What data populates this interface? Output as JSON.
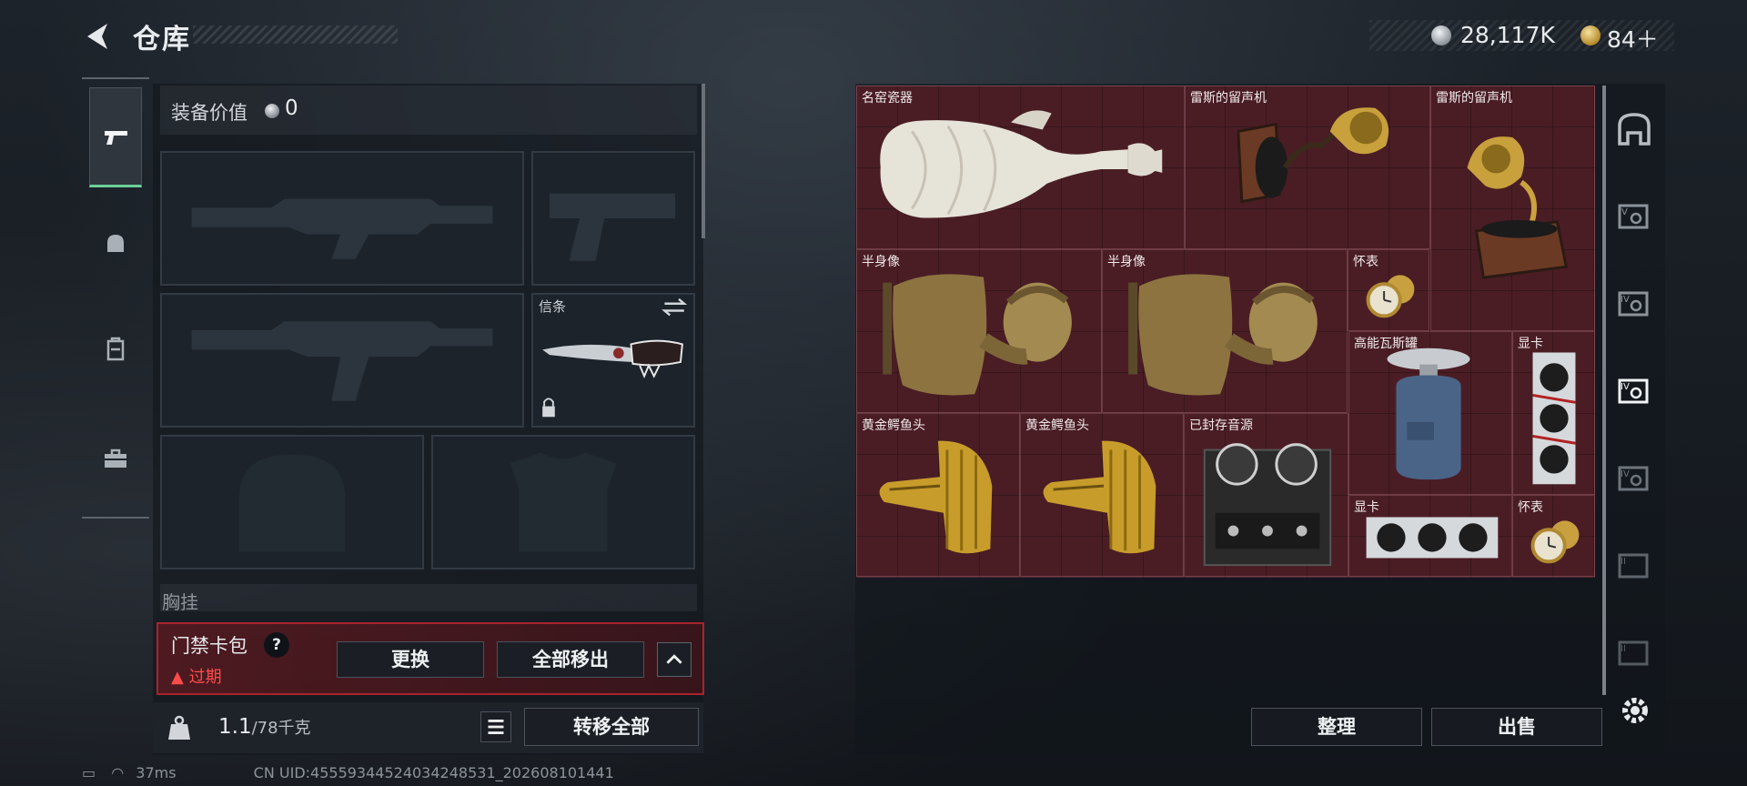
{
  "header": {
    "title": "仓库",
    "currency_silver": "28,117K",
    "currency_gold": "84＋"
  },
  "equipment": {
    "value_label": "装备价值",
    "value": "0",
    "melee_label": "信条",
    "chest_label": "胸挂"
  },
  "keycard": {
    "label": "门禁卡包",
    "help": "?",
    "status": "过期",
    "replace_button": "更换",
    "remove_all_button": "全部移出"
  },
  "weight": {
    "current": "1.1",
    "max": "/78千克",
    "transfer_all_button": "转移全部"
  },
  "stash": {
    "items": [
      {
        "name": "名窑瓷器",
        "kind": "vase"
      },
      {
        "name": "雷斯的留声机",
        "kind": "phonograph-1"
      },
      {
        "name": "雷斯的留声机",
        "kind": "phonograph-2"
      },
      {
        "name": "半身像",
        "kind": "bust"
      },
      {
        "name": "半身像",
        "kind": "bust"
      },
      {
        "name": "怀表",
        "kind": "pocket-watch"
      },
      {
        "name": "高能瓦斯罐",
        "kind": "gas-tank"
      },
      {
        "name": "显卡",
        "kind": "gpu-vertical"
      },
      {
        "name": "黄金鳄鱼头",
        "kind": "gold-croc"
      },
      {
        "name": "黄金鳄鱼头",
        "kind": "gold-croc"
      },
      {
        "name": "已封存音源",
        "kind": "reel-recorder"
      },
      {
        "name": "显卡",
        "kind": "gpu-horizontal"
      },
      {
        "name": "怀表",
        "kind": "pocket-watch"
      }
    ],
    "sort_button": "整理",
    "sell_button": "出售"
  },
  "status": {
    "ping": "37ms",
    "uid": "CN UID:45559344524034248531_202608101441"
  },
  "colors": {
    "accent_green": "#6ccf9a",
    "stash_bg": "#4a1d25",
    "warning_red": "#ff4b4b"
  }
}
